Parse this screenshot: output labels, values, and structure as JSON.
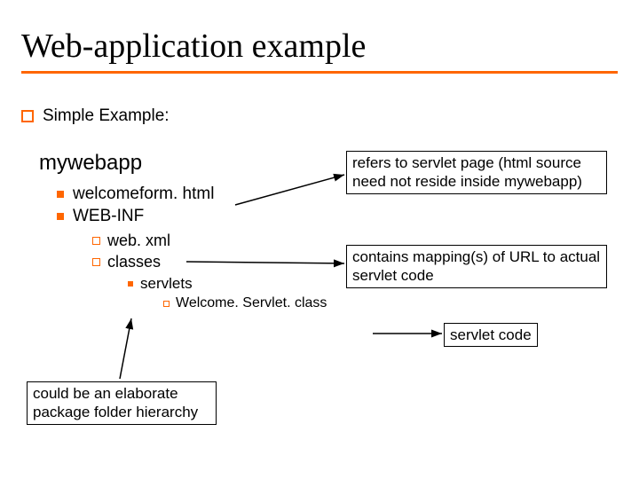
{
  "title": "Web-application example",
  "headline": "Simple Example:",
  "tree": {
    "root": "mywebapp",
    "items1_0": "welcomeform. html",
    "items1_1": "WEB-INF",
    "items2_0": "web. xml",
    "items2_1": "classes",
    "items3_0": "servlets",
    "items4_0": "Welcome. Servlet. class"
  },
  "notes": {
    "n1": "refers to servlet page (html source need not reside inside mywebapp)",
    "n2": "contains mapping(s) of URL to actual servlet code",
    "n3": "servlet code",
    "n4": "could be an elaborate package folder hierarchy"
  }
}
